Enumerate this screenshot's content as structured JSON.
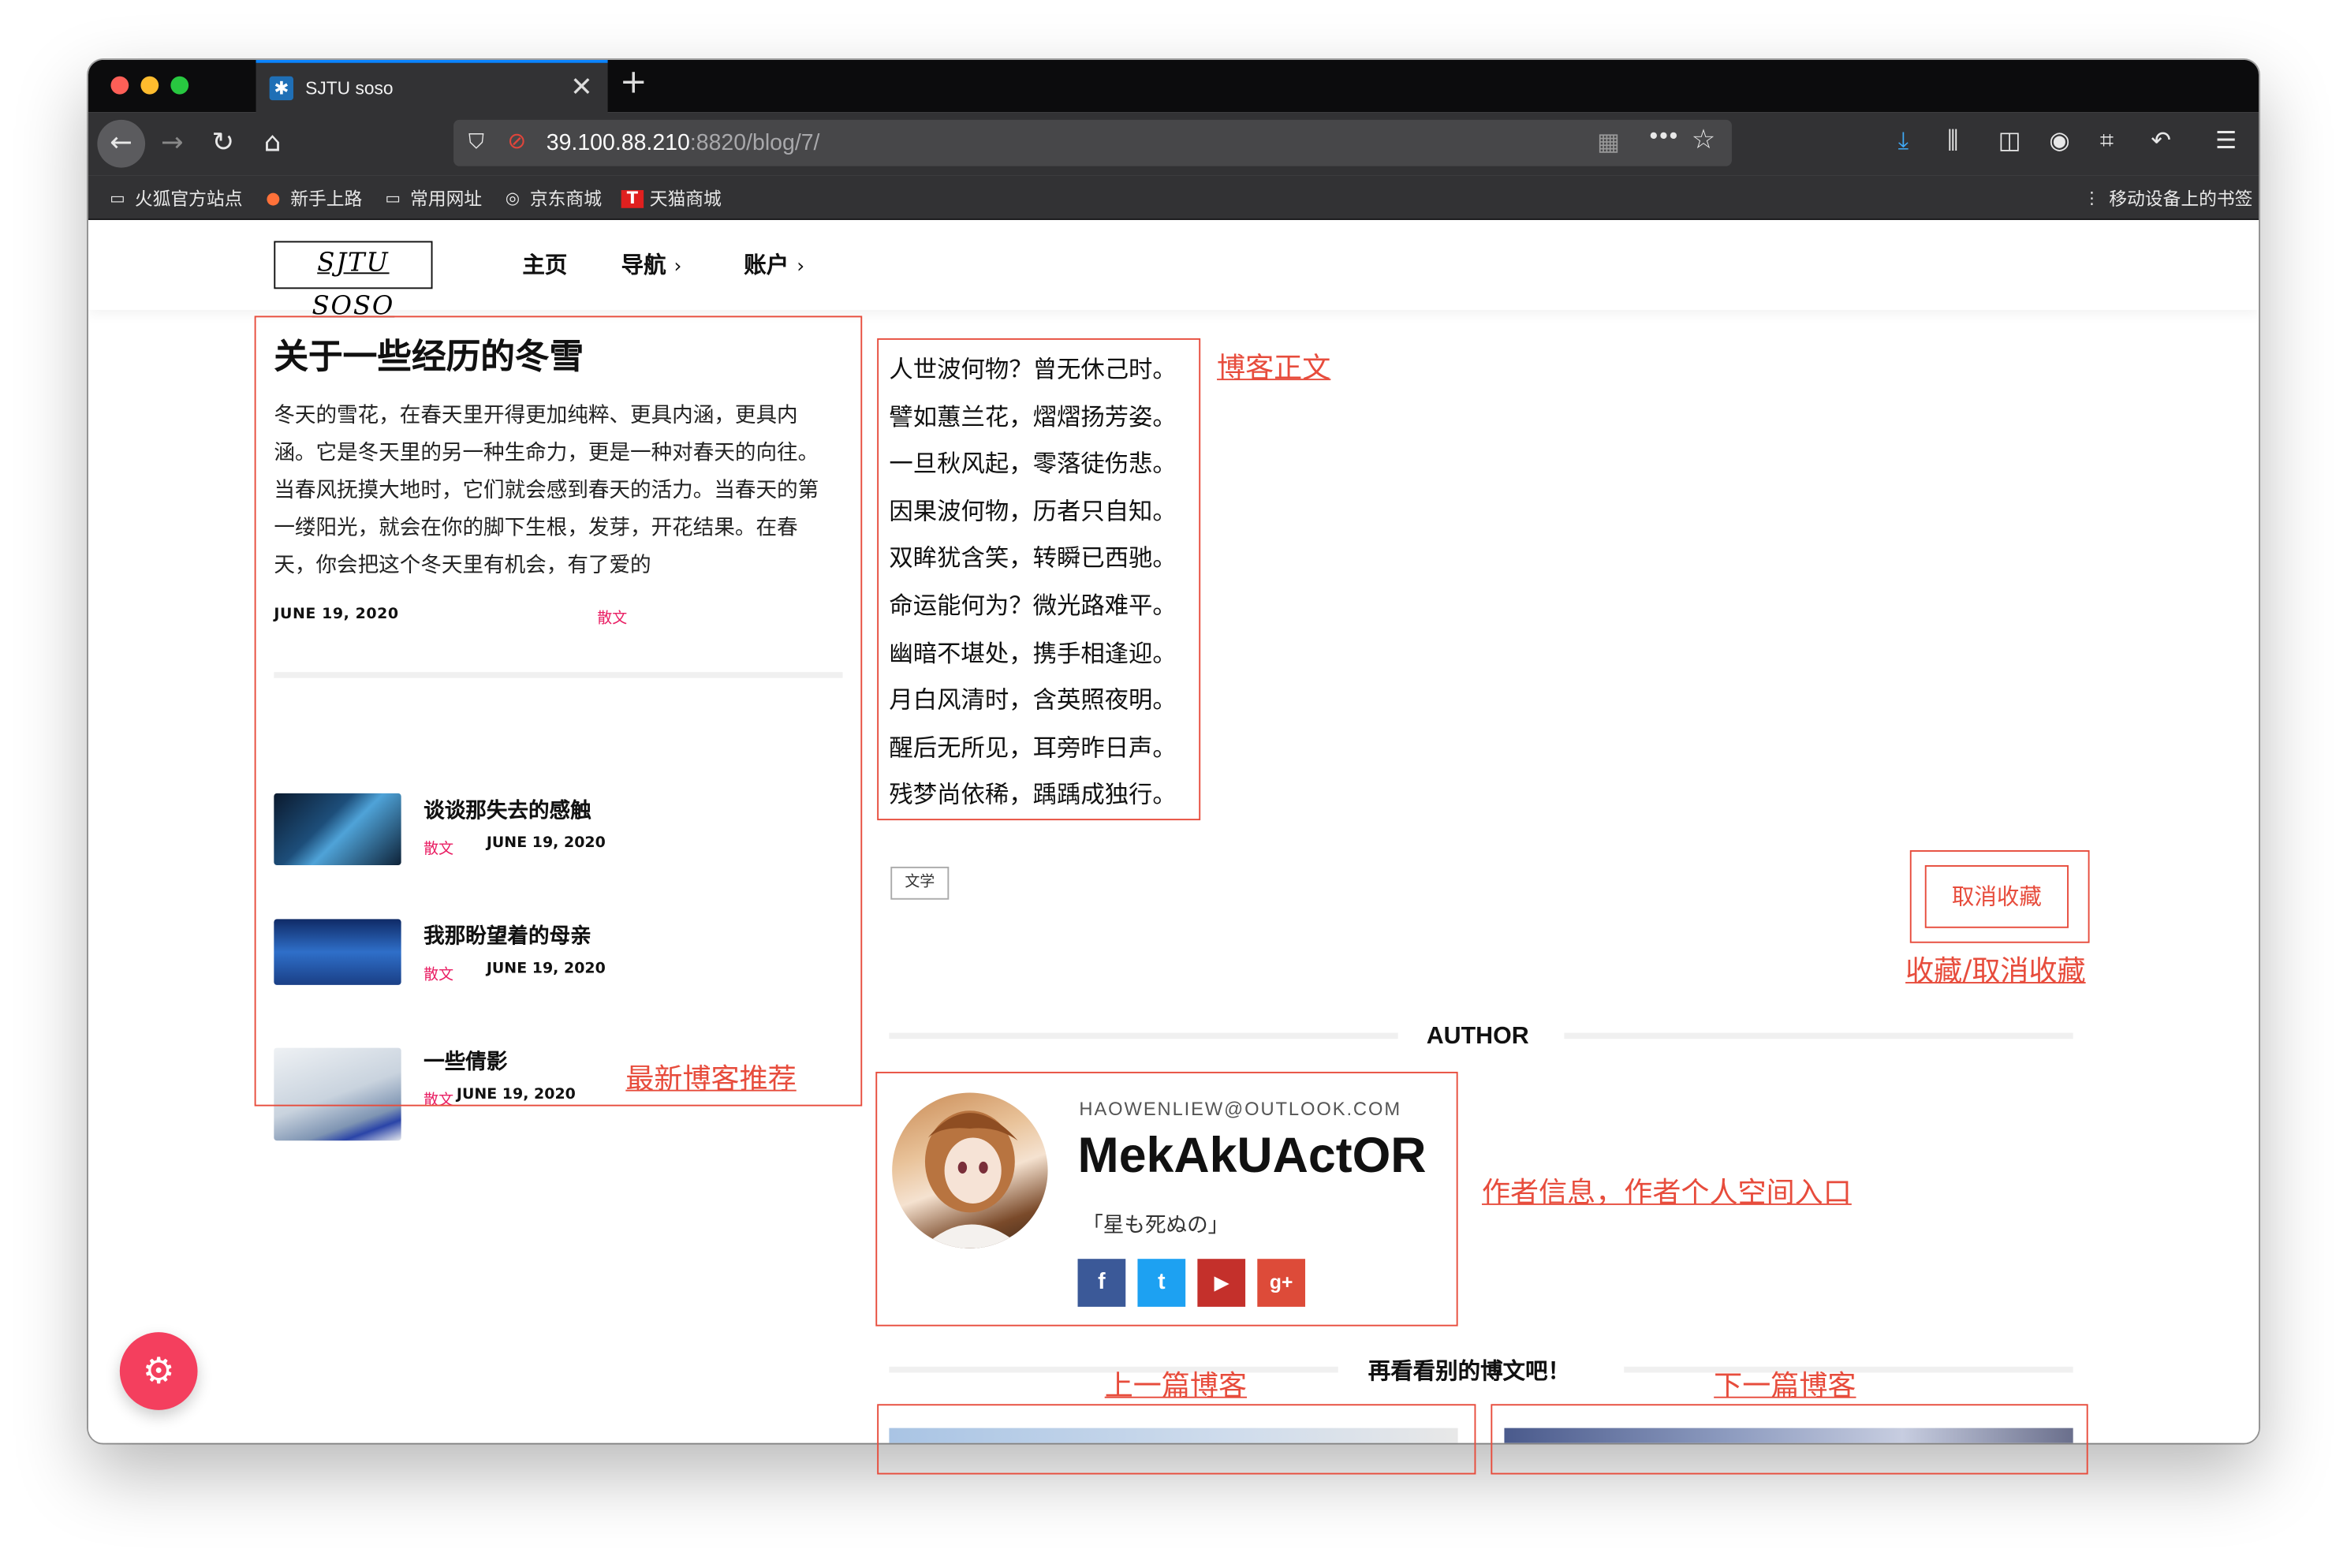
{
  "browser": {
    "tab_title": "SJTU soso",
    "url_host": "39.100.88.210",
    "url_path": ":8820/blog/7/",
    "bookmarks": [
      "火狐官方站点",
      "新手上路",
      "常用网址",
      "京东商城",
      "天猫商城"
    ],
    "mobile_bookmarks": "移动设备上的书签"
  },
  "site": {
    "logo": "SJTU SOSO",
    "nav": [
      "主页",
      "导航",
      "账户"
    ]
  },
  "featured": {
    "title": "关于一些经历的冬雪",
    "excerpt": "冬天的雪花，在春天里开得更加纯粹、更具内涵，更具内涵。它是冬天里的另一种生命力，更是一种对春天的向往。当春风抚摸大地时，它们就会感到春天的活力。当春天的第一缕阳光，就会在你的脚下生根，发芽，开花结果。在春天，你会把这个冬天里有机会，有了爱的",
    "date": "JUNE 19, 2020",
    "category": "散文"
  },
  "recent": [
    {
      "title": "谈谈那失去的感触",
      "category": "散文",
      "date": "JUNE 19, 2020"
    },
    {
      "title": "我那盼望着的母亲",
      "category": "散文",
      "date": "JUNE 19, 2020"
    },
    {
      "title": "一些倩影",
      "category": "散文",
      "date": "JUNE 19, 2020"
    }
  ],
  "poem": [
    "人世波何物？曾无休己时。",
    "譬如蕙兰花，熠熠扬芳姿。",
    "一旦秋风起，零落徒伤悲。",
    "因果波何物，历者只自知。",
    "双眸犹含笑，转瞬已西驰。",
    "命运能何为？微光路难平。",
    "幽暗不堪处，携手相逢迎。",
    "月白风清时，含英照夜明。",
    "醒后无所见，耳旁昨日声。",
    "残梦尚依稀，踽踽成独行。"
  ],
  "tag": "文学",
  "favorite_button": "取消收藏",
  "author": {
    "heading": "AUTHOR",
    "email": "HAOWENLIEW@OUTLOOK.COM",
    "name": "MekAkUActOR",
    "bio": "「星も死ぬの」",
    "socials": [
      "f",
      "t",
      "▶",
      "g+"
    ]
  },
  "more_heading": "再看看别的博文吧！",
  "annotations": {
    "body": "博客正文",
    "favorite": "收藏/取消收藏",
    "recent": "最新博客推荐",
    "author": "作者信息，作者个人空间入口",
    "prev": "上一篇博客",
    "next": "下一篇博客"
  },
  "colors": {
    "annotation": "#e74c3c",
    "category": "#e91e63",
    "fab": "#f43f5e",
    "tab_accent": "#0a84ff"
  }
}
